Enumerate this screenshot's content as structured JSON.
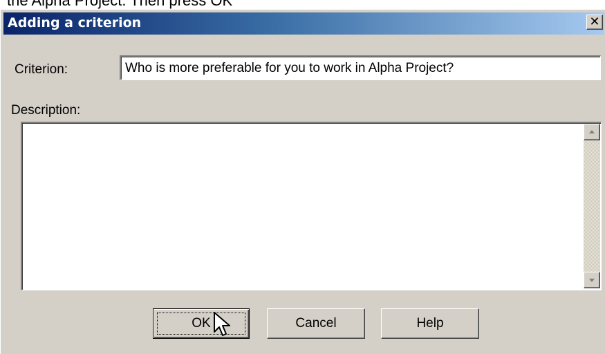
{
  "background_text": "the Alpha Project. Then press OK",
  "dialog": {
    "title": "Adding a criterion",
    "close_glyph": "✕",
    "criterion_label": "Criterion:",
    "criterion_value": "Who is more preferable for you to work in Alpha Project?",
    "description_label": "Description:",
    "description_value": ""
  },
  "buttons": {
    "ok_label": "OK",
    "cancel_label": "Cancel",
    "help_label": "Help"
  },
  "icons": {
    "close": "close-icon",
    "scroll_up": "scroll-up-arrow-icon",
    "scroll_down": "scroll-down-arrow-icon",
    "cursor": "mouse-pointer-icon"
  },
  "colors": {
    "titlebar_start": "#0a246a",
    "titlebar_end": "#a6caf0",
    "dialog_face": "#d4d0c8"
  }
}
